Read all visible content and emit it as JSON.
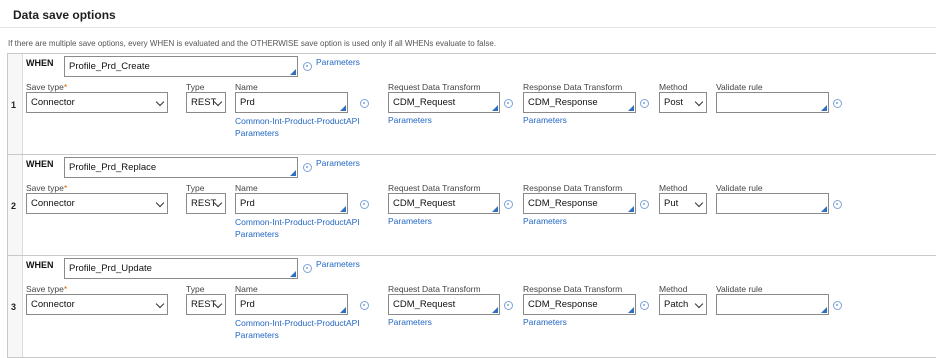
{
  "header": {
    "title": "Data save options",
    "note": "If there are multiple save options, every WHEN is evaluated and the OTHERWISE save option is used only if all WHENs evaluate to false."
  },
  "labels": {
    "when": "WHEN",
    "parameters": "Parameters",
    "save_type": "Save type",
    "required_mark": "*",
    "type": "Type",
    "name": "Name",
    "request_dt": "Request Data Transform",
    "response_dt": "Response Data Transform",
    "method": "Method",
    "validate_rule": "Validate rule"
  },
  "rows": [
    {
      "index": "1",
      "when": "Profile_Prd_Create",
      "save_type": "Connector",
      "type": "REST",
      "name": "Prd",
      "name_link": "Common-Int-Product-ProductAPI",
      "request_dt": "CDM_Request",
      "response_dt": "CDM_Response",
      "method": "Post",
      "validate_rule": ""
    },
    {
      "index": "2",
      "when": "Profile_Prd_Replace",
      "save_type": "Connector",
      "type": "REST",
      "name": "Prd",
      "name_link": "Common-Int-Product-ProductAPI",
      "request_dt": "CDM_Request",
      "response_dt": "CDM_Response",
      "method": "Put",
      "validate_rule": ""
    },
    {
      "index": "3",
      "when": "Profile_Prd_Update",
      "save_type": "Connector",
      "type": "REST",
      "name": "Prd",
      "name_link": "Common-Int-Product-ProductAPI",
      "request_dt": "CDM_Request",
      "response_dt": "CDM_Response",
      "method": "Patch",
      "validate_rule": ""
    }
  ],
  "colors": {
    "link": "#2467c5",
    "required": "#d46600",
    "corner": "#2e6fc2"
  }
}
